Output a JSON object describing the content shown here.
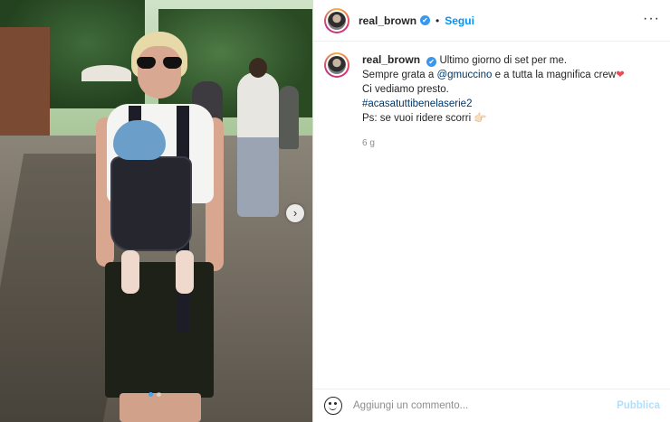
{
  "post": {
    "username": "real_brown",
    "verified_glyph": "✔",
    "separator": "•",
    "follow_label": "Segui",
    "more_glyph": "···"
  },
  "caption": {
    "username": "real_brown",
    "line1": "Ultimo giorno di set per me.",
    "line2_pre": "Sempre grata a ",
    "line2_mention": "@gmuccino",
    "line2_post": " e a tutta la magnifica crew",
    "heart": "❤",
    "line3": "Ci vediamo presto.",
    "hashtag": "#acasatuttibenelaserie2",
    "line5": "Ps: se vuoi ridere scorri",
    "pointing_emoji": "👉🏻",
    "time": "6 g"
  },
  "carousel": {
    "next_glyph": "›",
    "current_slide": 1,
    "total_slides": 2
  },
  "comment": {
    "placeholder": "Aggiungi un commento...",
    "publish_label": "Pubblica"
  },
  "icons": {
    "emoji": "emoji-icon",
    "more": "more-options-icon",
    "next": "chevron-right-icon",
    "verified": "verified-badge-icon"
  },
  "colors": {
    "link_blue": "#0095f6",
    "tag_color": "#00376b",
    "publish_disabled": "#b2dffc",
    "carousel_active_dot": "#4aa3f0"
  }
}
